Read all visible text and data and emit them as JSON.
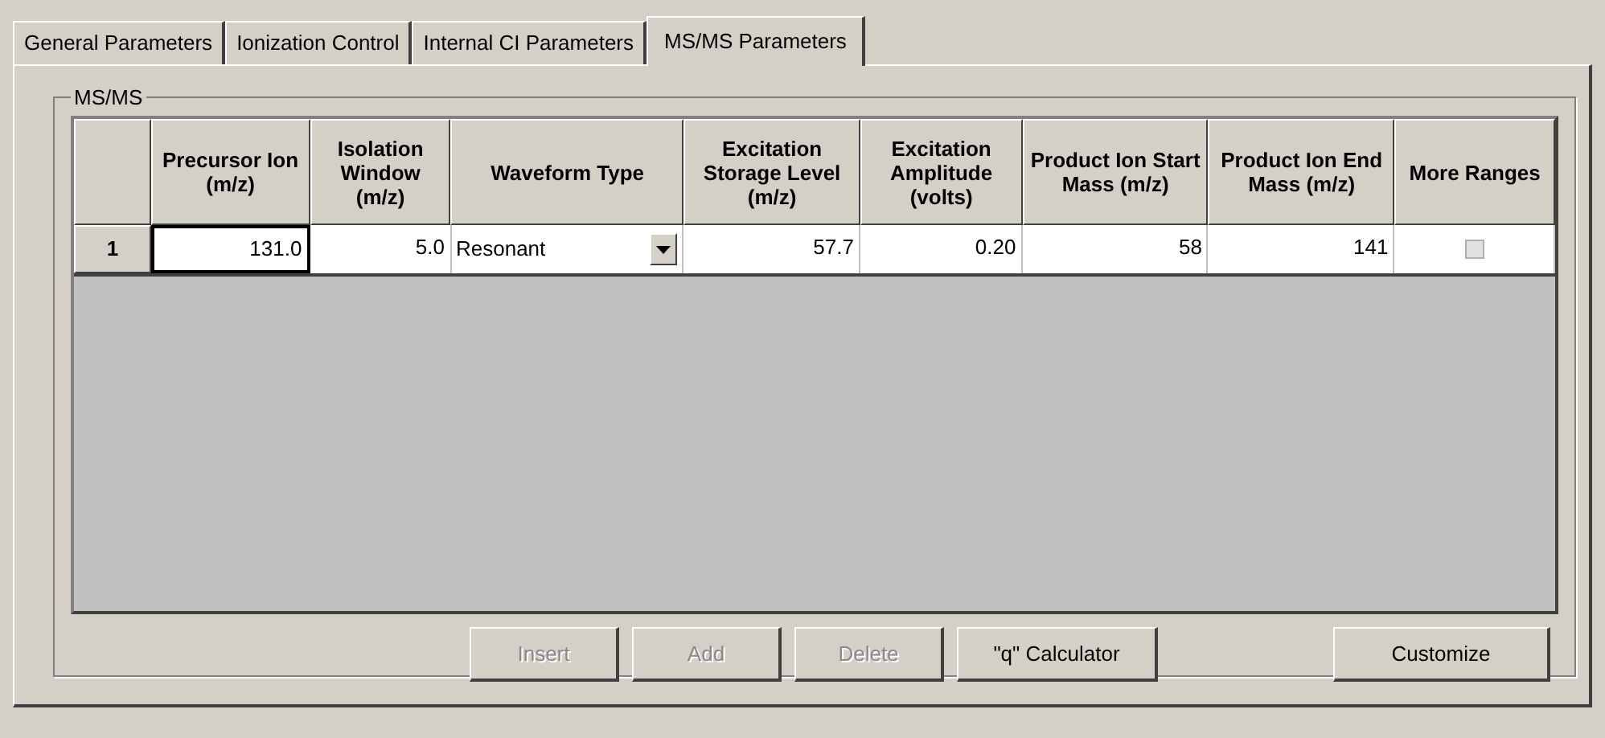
{
  "tabs": [
    {
      "label": "General Parameters",
      "selected": false
    },
    {
      "label": "Ionization Control",
      "selected": false
    },
    {
      "label": "Internal CI Parameters",
      "selected": false
    },
    {
      "label": "MS/MS Parameters",
      "selected": true
    }
  ],
  "group": {
    "title": "MS/MS"
  },
  "table": {
    "columns": [
      "Precursor Ion (m/z)",
      "Isolation Window (m/z)",
      "Waveform Type",
      "Excitation Storage Level (m/z)",
      "Excitation Amplitude (volts)",
      "Product Ion Start Mass (m/z)",
      "Product Ion End Mass (m/z)",
      "More Ranges"
    ],
    "rows": [
      {
        "number": "1",
        "precursor": "131.0",
        "isolation": "5.0",
        "waveform": "Resonant",
        "storage": "57.7",
        "amplitude": "0.20",
        "start_mass": "58",
        "end_mass": "141",
        "more_ranges": false
      }
    ]
  },
  "buttons": [
    {
      "label": "Insert",
      "disabled": true
    },
    {
      "label": "Add",
      "disabled": true
    },
    {
      "label": "Delete",
      "disabled": true
    },
    {
      "label": "\"q\" Calculator",
      "disabled": false
    },
    {
      "label": "Customize",
      "disabled": false
    }
  ]
}
